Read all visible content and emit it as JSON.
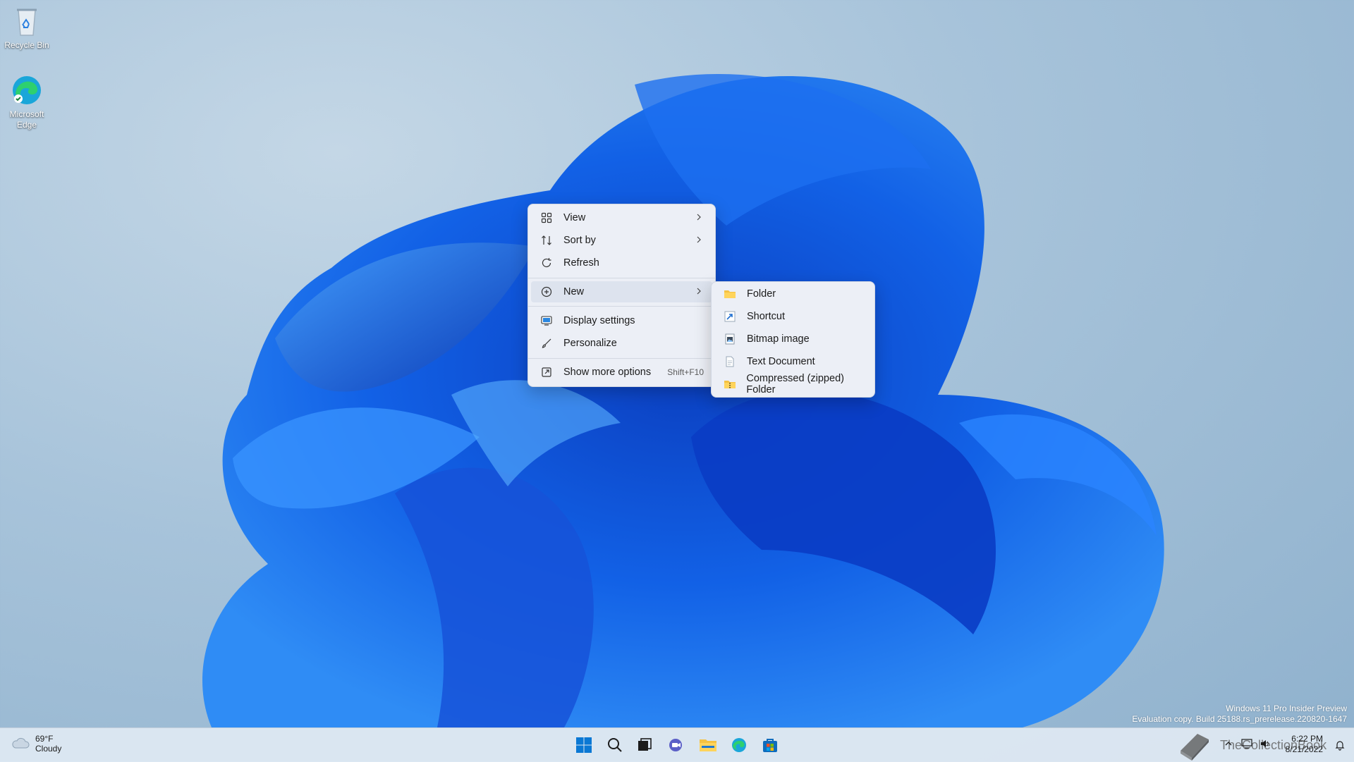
{
  "desktop": {
    "icons": [
      {
        "label": "Recycle Bin",
        "icon": "recycle-bin-icon"
      },
      {
        "label": "Microsoft Edge",
        "icon": "edge-icon"
      }
    ]
  },
  "context_menu": {
    "items": [
      {
        "label": "View",
        "icon": "grid-icon",
        "submenu": true
      },
      {
        "label": "Sort by",
        "icon": "sort-icon",
        "submenu": true
      },
      {
        "label": "Refresh",
        "icon": "refresh-icon"
      },
      {
        "label": "New",
        "icon": "plus-circle-icon",
        "submenu": true,
        "highlighted": true
      },
      {
        "label": "Display settings",
        "icon": "display-icon"
      },
      {
        "label": "Personalize",
        "icon": "brush-icon"
      },
      {
        "label": "Show more options",
        "icon": "share-icon",
        "shortcut": "Shift+F10"
      }
    ]
  },
  "new_submenu": {
    "items": [
      {
        "label": "Folder",
        "icon": "folder-icon"
      },
      {
        "label": "Shortcut",
        "icon": "shortcut-arrow-icon"
      },
      {
        "label": "Bitmap image",
        "icon": "bitmap-icon"
      },
      {
        "label": "Text Document",
        "icon": "text-document-icon"
      },
      {
        "label": "Compressed (zipped) Folder",
        "icon": "zip-folder-icon"
      }
    ]
  },
  "watermark": {
    "line1": "Windows 11 Pro Insider Preview",
    "line2": "Evaluation copy. Build 25188.rs_prerelease.220820-1647"
  },
  "taskbar": {
    "weather": {
      "temp": "69°F",
      "condition": "Cloudy"
    },
    "apps": [
      "start-icon",
      "search-icon",
      "task-view-icon",
      "chat-icon",
      "file-explorer-icon",
      "edge-icon",
      "store-icon"
    ],
    "clock": {
      "time": "6:22 PM",
      "date": "8/21/2022"
    },
    "overlay_text": "TheCollectionBook"
  },
  "colors": {
    "accent": "#0067c0",
    "menu_bg": "#eceff6"
  }
}
